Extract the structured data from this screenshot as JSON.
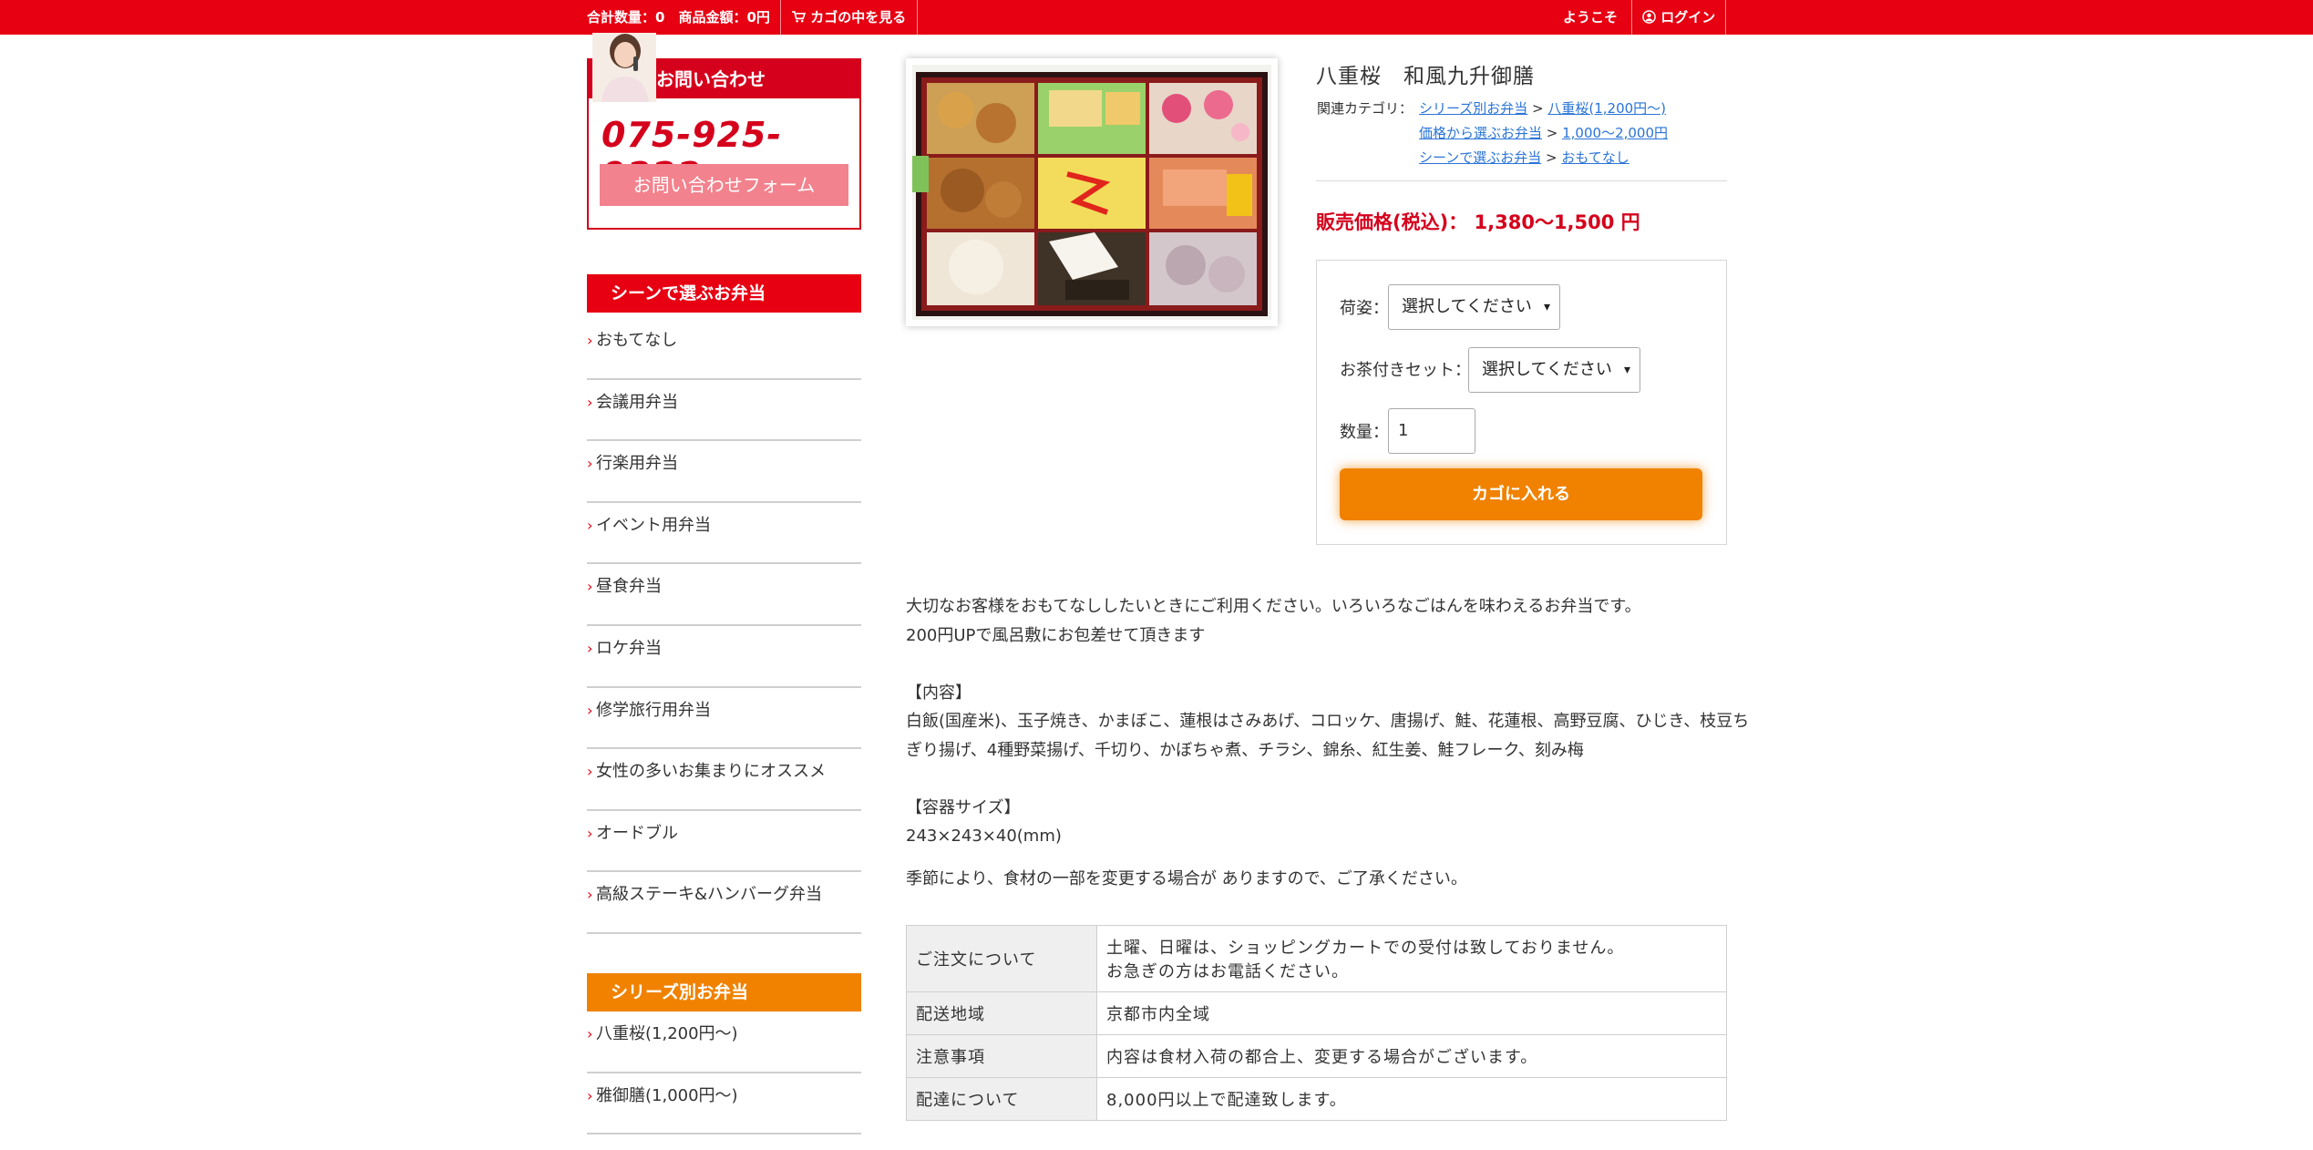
{
  "topbar": {
    "summary": "合計数量：0　商品金額：0円",
    "cart_link": "カゴの中を見る",
    "welcome": "ようこそ",
    "login": "ログイン"
  },
  "contact": {
    "heading": "お問い合わせ",
    "phone": "075-925-9222",
    "form_button": "お問い合わせフォーム"
  },
  "sidebar": {
    "scene_heading": "シーンで選ぶお弁当",
    "scene_items": [
      "おもてなし",
      "会議用弁当",
      "行楽用弁当",
      "イベント用弁当",
      "昼食弁当",
      "ロケ弁当",
      "修学旅行用弁当",
      "女性の多いお集まりにオススメ",
      "オードブル",
      "高級ステーキ&ハンバーグ弁当"
    ],
    "series_heading": "シリーズ別お弁当",
    "series_items": [
      "八重桜(1,200円〜)",
      "雅御膳(1,000円〜)"
    ]
  },
  "product": {
    "title": "八重桜　和風九升御膳",
    "category_label": "関連カテゴリ：",
    "categories": [
      {
        "parent": "シリーズ別お弁当",
        "child": "八重桜(1,200円〜)"
      },
      {
        "parent": "価格から選ぶお弁当",
        "child": "1,000〜2,000円"
      },
      {
        "parent": "シーンで選ぶお弁当",
        "child": "おもてなし"
      }
    ],
    "price_label": "販売価格(税込)：",
    "price_value": "1,380〜1,500 円"
  },
  "order": {
    "packing_label": "荷姿：",
    "packing_value": "選択してください",
    "tea_label": "お茶付きセット：",
    "tea_value": "選択してください",
    "qty_label": "数量：",
    "qty_value": "1",
    "add_to_cart": "カゴに入れる"
  },
  "description": {
    "line1": "大切なお客様をおもてなししたいときにご利用ください。いろいろなごはんを味わえるお弁当です。",
    "line2": "200円UPで風呂敷にお包差せて頂きます",
    "contents_heading": "【内容】",
    "contents_line1": "白飯(国産米)、玉子焼き、かまぼこ、蓮根はさみあげ、コロッケ、唐揚げ、鮭、花蓮根、高野豆腐、ひじき、枝豆ち",
    "contents_line2": "ぎり揚げ、4種野菜揚げ、千切り、かぼちゃ煮、チラシ、錦糸、紅生姜、鮭フレーク、刻み梅",
    "size_heading": "【容器サイズ】",
    "size_value": "243×243×40(mm)",
    "season_note": "季節により、食材の一部を変更する場合が ありますので、ご了承ください。"
  },
  "info_table": [
    {
      "label": "ご注文について",
      "value1": "土曜、日曜は、ショッピングカートでの受付は致しておりません。",
      "value2": "お急ぎの方はお電話ください。"
    },
    {
      "label": "配送地域",
      "value1": "京都市内全域"
    },
    {
      "label": "注意事項",
      "value1": "内容は食材入荷の都合上、変更する場合がございます。"
    },
    {
      "label": "配達について",
      "value1": "8,000円以上で配達致します。"
    }
  ],
  "colors": {
    "brand_red": "#e60012",
    "accent_orange": "#f08200",
    "link_blue": "#2a74d6",
    "price_red": "#d5001c"
  },
  "icons": {
    "cart": "cart-icon",
    "login": "user-circle-icon",
    "chevron": "chevron-right-icon"
  }
}
